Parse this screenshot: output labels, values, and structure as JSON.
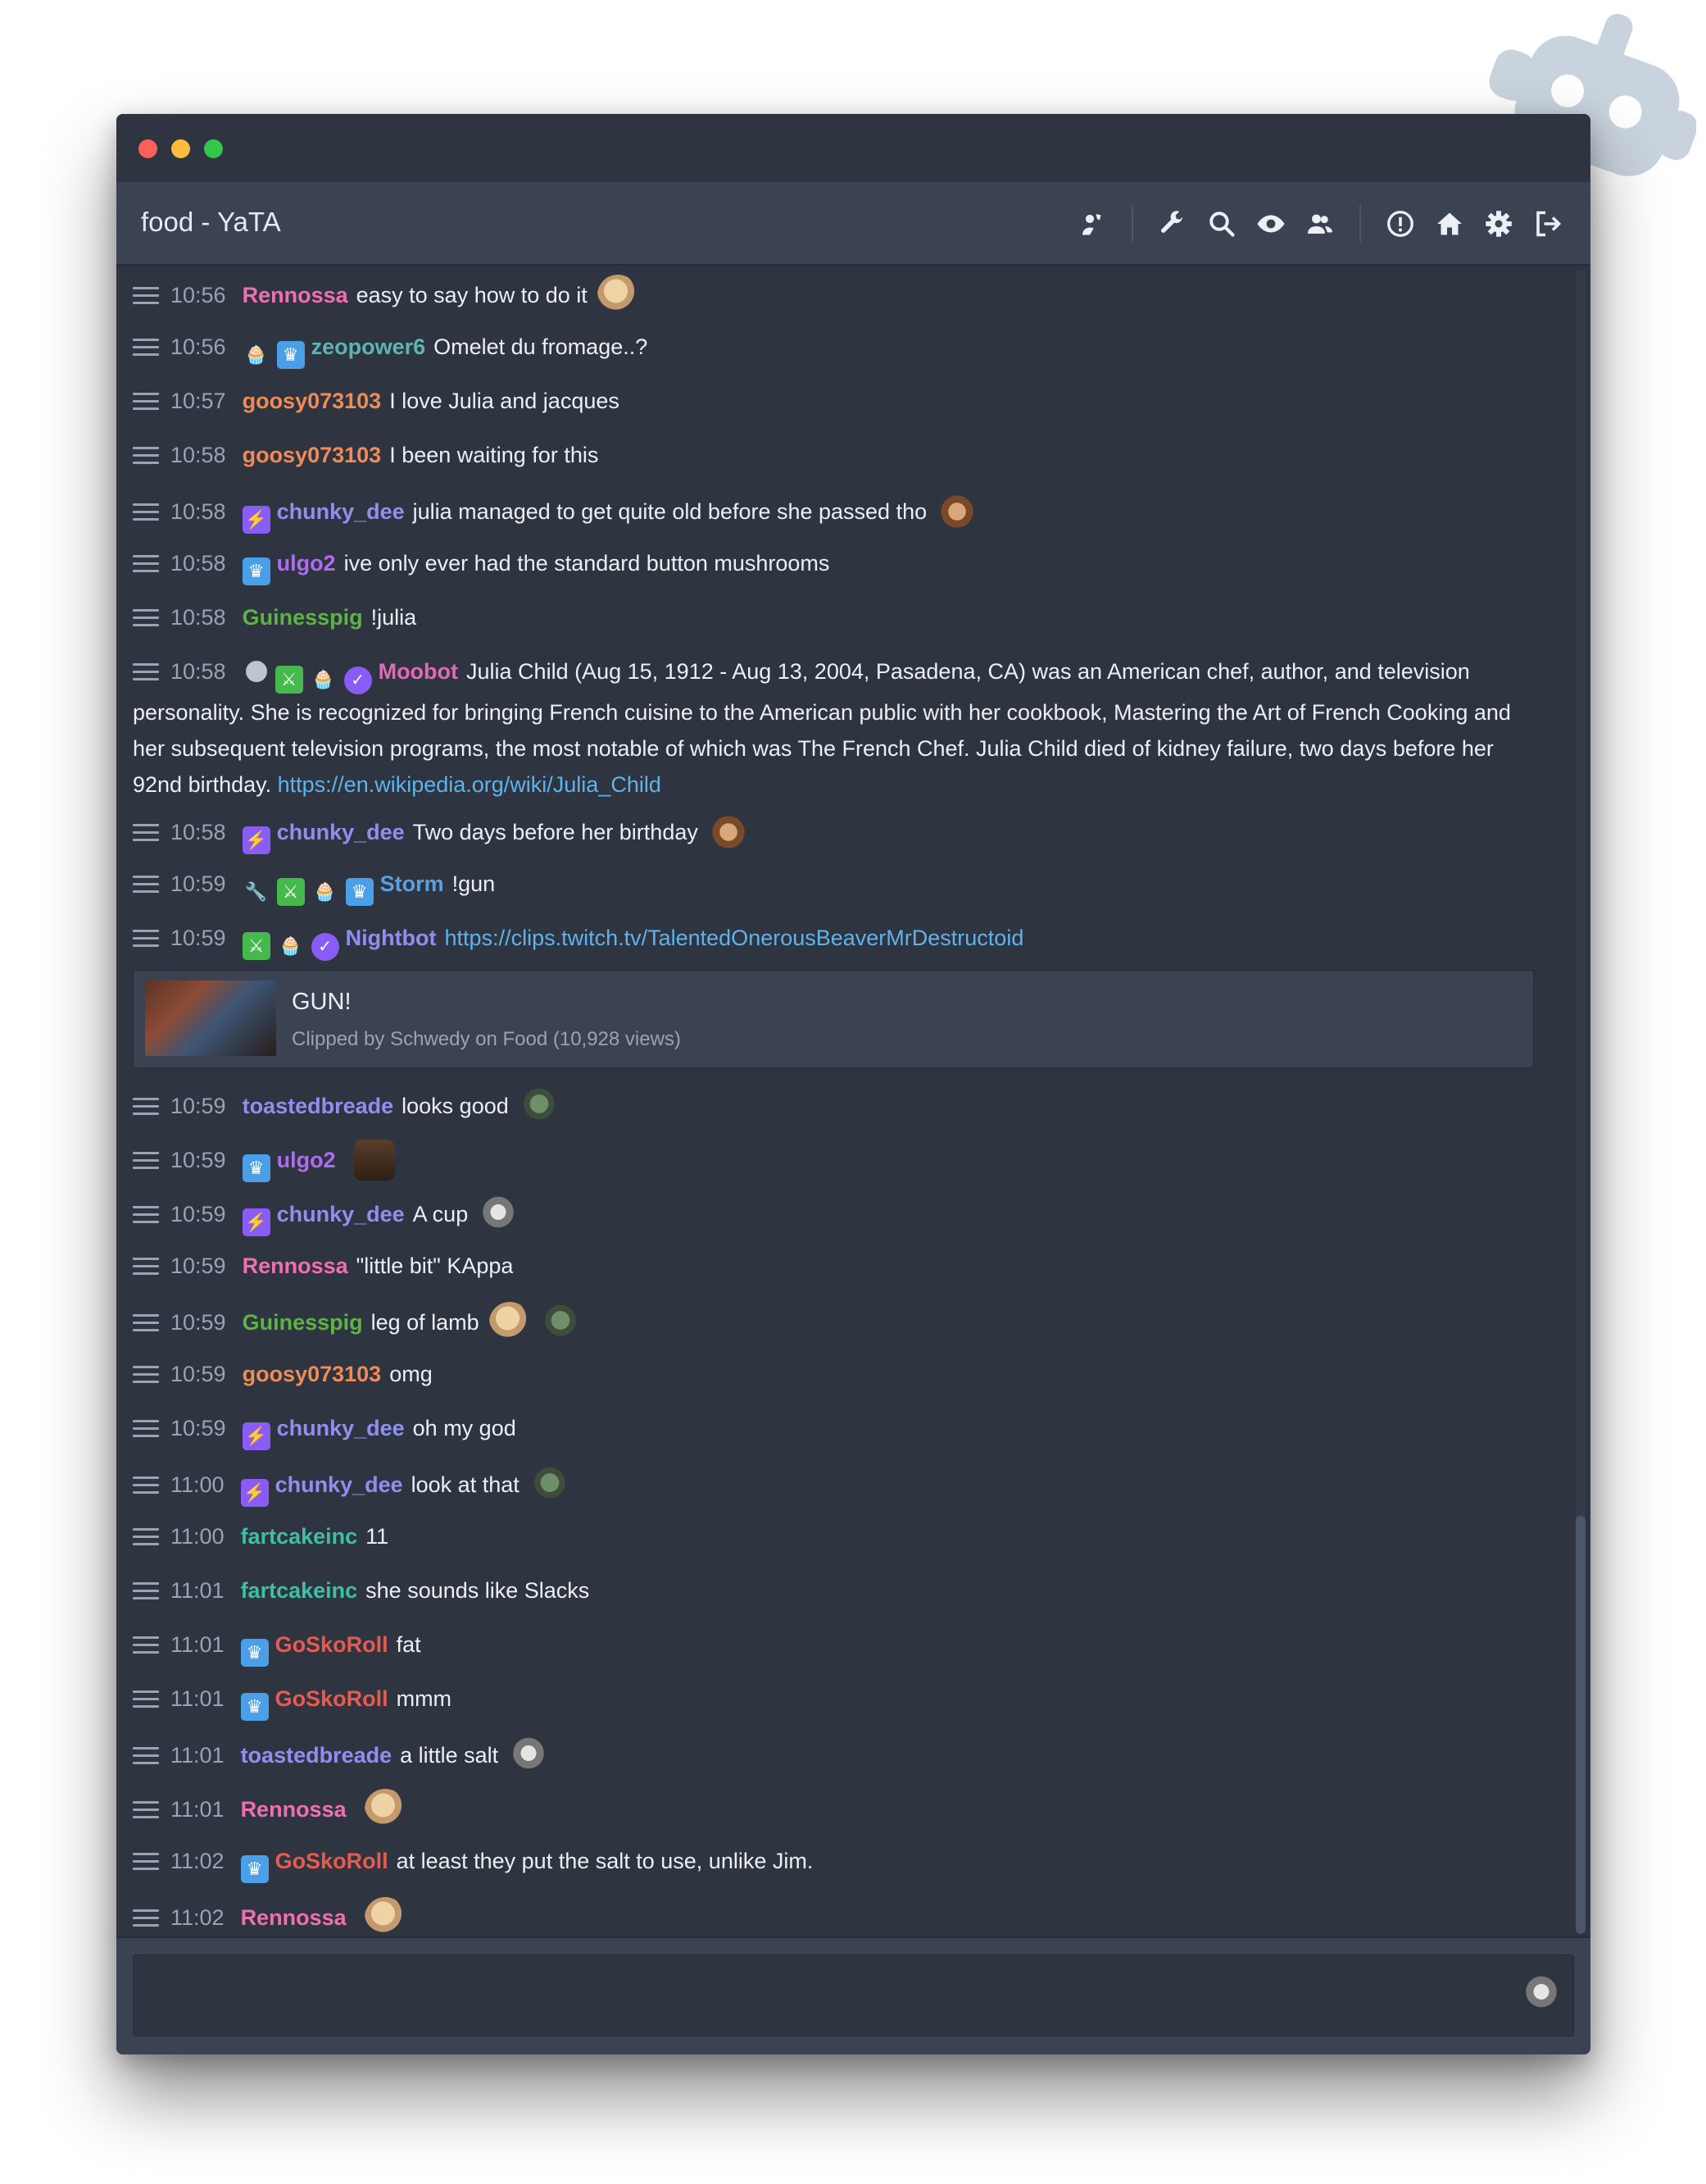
{
  "window": {
    "title": "food - YaTA"
  },
  "header_icons": [
    "user-mod-icon",
    "wrench-icon",
    "search-icon",
    "eye-icon",
    "users-icon",
    "alert-icon",
    "home-icon",
    "gear-icon",
    "logout-icon"
  ],
  "messages": [
    {
      "time": "10:56",
      "badges": [],
      "user": "Rennossa",
      "color": "#f06fb0",
      "text": "easy to say how to do it",
      "emotes": [
        "face"
      ]
    },
    {
      "time": "10:56",
      "badges": [
        "cupcake",
        "crown"
      ],
      "user": "zeopower6",
      "color": "#5eb3b3",
      "text": "Omelet du fromage..?",
      "emotes": []
    },
    {
      "time": "10:57",
      "badges": [],
      "user": "goosy073103",
      "color": "#f08a56",
      "text": "I love Julia and jacques",
      "emotes": []
    },
    {
      "time": "10:58",
      "badges": [],
      "user": "goosy073103",
      "color": "#f08a56",
      "text": "I been waiting for this",
      "emotes": []
    },
    {
      "time": "10:58",
      "badges": [
        "prime"
      ],
      "user": "chunky_dee",
      "color": "#8f8ff0",
      "text": "julia managed to get quite old before she passed tho",
      "emotes": [
        "monkey"
      ]
    },
    {
      "time": "10:58",
      "badges": [
        "crown"
      ],
      "user": "ulgo2",
      "color": "#b06cf0",
      "text": "ive only ever had the standard button mushrooms",
      "emotes": []
    },
    {
      "time": "10:58",
      "badges": [],
      "user": "Guinesspig",
      "color": "#5fb245",
      "text": "!julia",
      "emotes": []
    },
    {
      "time": "10:58",
      "badges": [
        "mod",
        "sword",
        "cupcake",
        "verified"
      ],
      "user": "Moobot",
      "color": "#e06ab8",
      "text": "Julia Child (Aug 15, 1912 - Aug 13, 2004, Pasadena, CA) was an American chef, author, and television personality. She is recognized for bringing French cuisine to the American public with her cookbook, Mastering the Art of French Cooking and her subsequent television programs, the most notable of which was The French Chef. Julia Child died of kidney failure, two days before her 92nd birthday.",
      "link": "https://en.wikipedia.org/wiki/Julia_Child",
      "emotes": []
    },
    {
      "time": "10:58",
      "badges": [
        "prime"
      ],
      "user": "chunky_dee",
      "color": "#8f8ff0",
      "text": "Two days before her birthday",
      "emotes": [
        "monkey"
      ]
    },
    {
      "time": "10:59",
      "badges": [
        "wrench",
        "sword",
        "cupcake",
        "crown"
      ],
      "user": "Storm",
      "color": "#5e9fe0",
      "text": "!gun",
      "emotes": []
    },
    {
      "time": "10:59",
      "badges": [
        "sword",
        "cupcake",
        "verified"
      ],
      "user": "Nightbot",
      "color": "#8f8ff0",
      "text": "",
      "link": "https://clips.twitch.tv/TalentedOnerousBeaverMrDestructoid",
      "emotes": []
    }
  ],
  "clip": {
    "title": "GUN!",
    "subtitle": "Clipped by Schwedy on Food (10,928 views)"
  },
  "messages2": [
    {
      "time": "10:59",
      "badges": [],
      "user": "toastedbreade",
      "color": "#8f8ff0",
      "text": "looks good",
      "emotes": [
        "green"
      ]
    },
    {
      "time": "10:59",
      "badges": [
        "crown"
      ],
      "user": "ulgo2",
      "color": "#b06cf0",
      "text": "",
      "emotes": [
        "pepe"
      ]
    },
    {
      "time": "10:59",
      "badges": [
        "prime"
      ],
      "user": "chunky_dee",
      "color": "#8f8ff0",
      "text": "A cup",
      "emotes": [
        "gray"
      ]
    },
    {
      "time": "10:59",
      "badges": [],
      "user": "Rennossa",
      "color": "#f06fb0",
      "text": "\"little bit\" KAppa",
      "emotes": []
    },
    {
      "time": "10:59",
      "badges": [],
      "user": "Guinesspig",
      "color": "#5fb245",
      "text": "leg of lamb",
      "emotes": [
        "face",
        "green"
      ]
    },
    {
      "time": "10:59",
      "badges": [],
      "user": "goosy073103",
      "color": "#f08a56",
      "text": "omg",
      "emotes": []
    },
    {
      "time": "10:59",
      "badges": [
        "prime"
      ],
      "user": "chunky_dee",
      "color": "#8f8ff0",
      "text": "oh my god",
      "emotes": []
    },
    {
      "time": "11:00",
      "badges": [
        "prime"
      ],
      "user": "chunky_dee",
      "color": "#8f8ff0",
      "text": "look at that",
      "emotes": [
        "green"
      ]
    },
    {
      "time": "11:00",
      "badges": [],
      "user": "fartcakeinc",
      "color": "#3fbfa5",
      "text": "11",
      "emotes": []
    },
    {
      "time": "11:01",
      "badges": [],
      "user": "fartcakeinc",
      "color": "#3fbfa5",
      "text": "she sounds like Slacks",
      "emotes": []
    },
    {
      "time": "11:01",
      "badges": [
        "crown"
      ],
      "user": "GoSkoRoll",
      "color": "#e85a4f",
      "text": "fat",
      "emotes": []
    },
    {
      "time": "11:01",
      "badges": [
        "crown"
      ],
      "user": "GoSkoRoll",
      "color": "#e85a4f",
      "text": "mmm",
      "emotes": []
    },
    {
      "time": "11:01",
      "badges": [],
      "user": "toastedbreade",
      "color": "#8f8ff0",
      "text": "a little salt",
      "emotes": [
        "gray"
      ]
    },
    {
      "time": "11:01",
      "badges": [],
      "user": "Rennossa",
      "color": "#f06fb0",
      "text": "",
      "emotes": [
        "face"
      ]
    },
    {
      "time": "11:02",
      "badges": [
        "crown"
      ],
      "user": "GoSkoRoll",
      "color": "#e85a4f",
      "text": "at least they put the salt to use, unlike Jim.",
      "emotes": []
    },
    {
      "time": "11:02",
      "badges": [],
      "user": "Rennossa",
      "color": "#f06fb0",
      "text": "",
      "emotes": [
        "face"
      ]
    }
  ],
  "input": {
    "value": "",
    "placeholder": ""
  }
}
